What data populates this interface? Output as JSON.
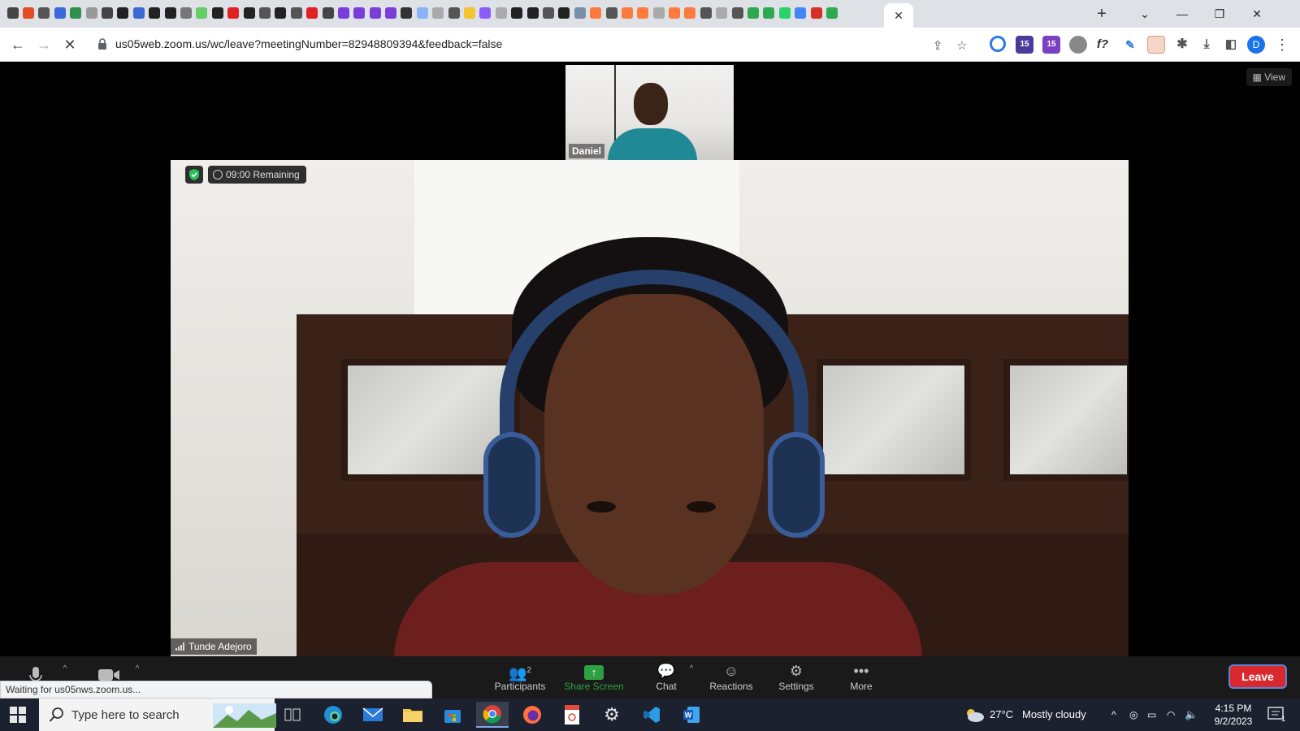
{
  "browser": {
    "url": "us05web.zoom.us/wc/leave?meetingNumber=82948809394&feedback=false",
    "active_tab_close": "✕",
    "new_tab": "+",
    "extension_badge_1": "15",
    "extension_badge_2": "15",
    "extension_fx": "f?",
    "profile_initial": "D"
  },
  "meeting": {
    "view_label": "View",
    "thumbnail_name": "Daniel",
    "timer_text": "09:00 Remaining",
    "speaker_name": "Tunde Adejoro",
    "status_text": "Waiting for us05nws.zoom.us...",
    "leave_label": "Leave",
    "participants_count": "2",
    "controls": {
      "participants": "Participants",
      "share": "Share Screen",
      "chat": "Chat",
      "reactions": "Reactions",
      "settings": "Settings",
      "more": "More"
    }
  },
  "taskbar": {
    "search_placeholder": "Type here to search",
    "weather_temp": "27°C",
    "weather_text": "Mostly cloudy",
    "time": "4:15 PM",
    "date": "9/2/2023",
    "notification_count": "1"
  },
  "colors": {
    "share_green": "#2ea043",
    "leave_red": "#d9282f",
    "taskbar_bg": "#1c2130",
    "chrome_tabstrip": "#dee1e6"
  }
}
